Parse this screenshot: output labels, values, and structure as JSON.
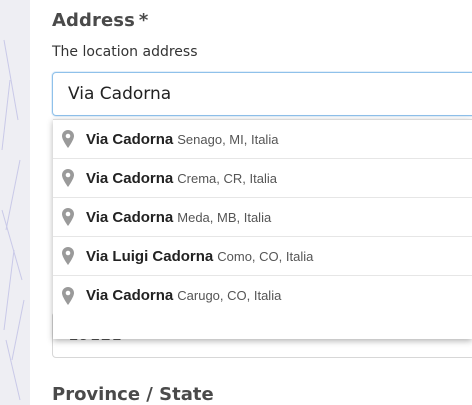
{
  "form": {
    "address_label": "Address",
    "required_marker": "*",
    "address_help": "The location address",
    "address_value": "Via Cadorna",
    "obscured_field_value": "19121",
    "province_label": "Province / State"
  },
  "suggestions": [
    {
      "main": "Via Cadorna",
      "secondary": "Senago, MI, Italia",
      "icon": "map-pin-icon"
    },
    {
      "main": "Via Cadorna",
      "secondary": "Crema, CR, Italia",
      "icon": "map-pin-icon"
    },
    {
      "main": "Via Cadorna",
      "secondary": "Meda, MB, Italia",
      "icon": "map-pin-icon"
    },
    {
      "main": "Via Luigi Cadorna",
      "secondary": "Como, CO, Italia",
      "icon": "map-pin-icon"
    },
    {
      "main": "Via Cadorna",
      "secondary": "Carugo, CO, Italia",
      "icon": "map-pin-icon"
    }
  ],
  "colors": {
    "input_focus_border": "#8fc1ea",
    "pin_icon": "#9a9a9a",
    "label_text": "#4a4a4a"
  }
}
